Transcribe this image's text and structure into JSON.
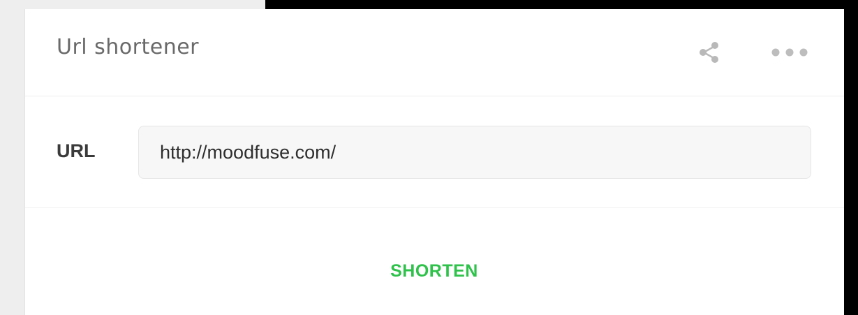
{
  "card": {
    "title": "Url shortener",
    "header_icons": {
      "share": "share-icon",
      "more": "more-horizontal-icon"
    }
  },
  "form": {
    "url_label": "URL",
    "url_value": "http://moodfuse.com/"
  },
  "actions": {
    "shorten_label": "SHORTEN"
  },
  "colors": {
    "accent": "#2ec24a",
    "background_right": "#000000",
    "background_left": "#eeeeee"
  }
}
